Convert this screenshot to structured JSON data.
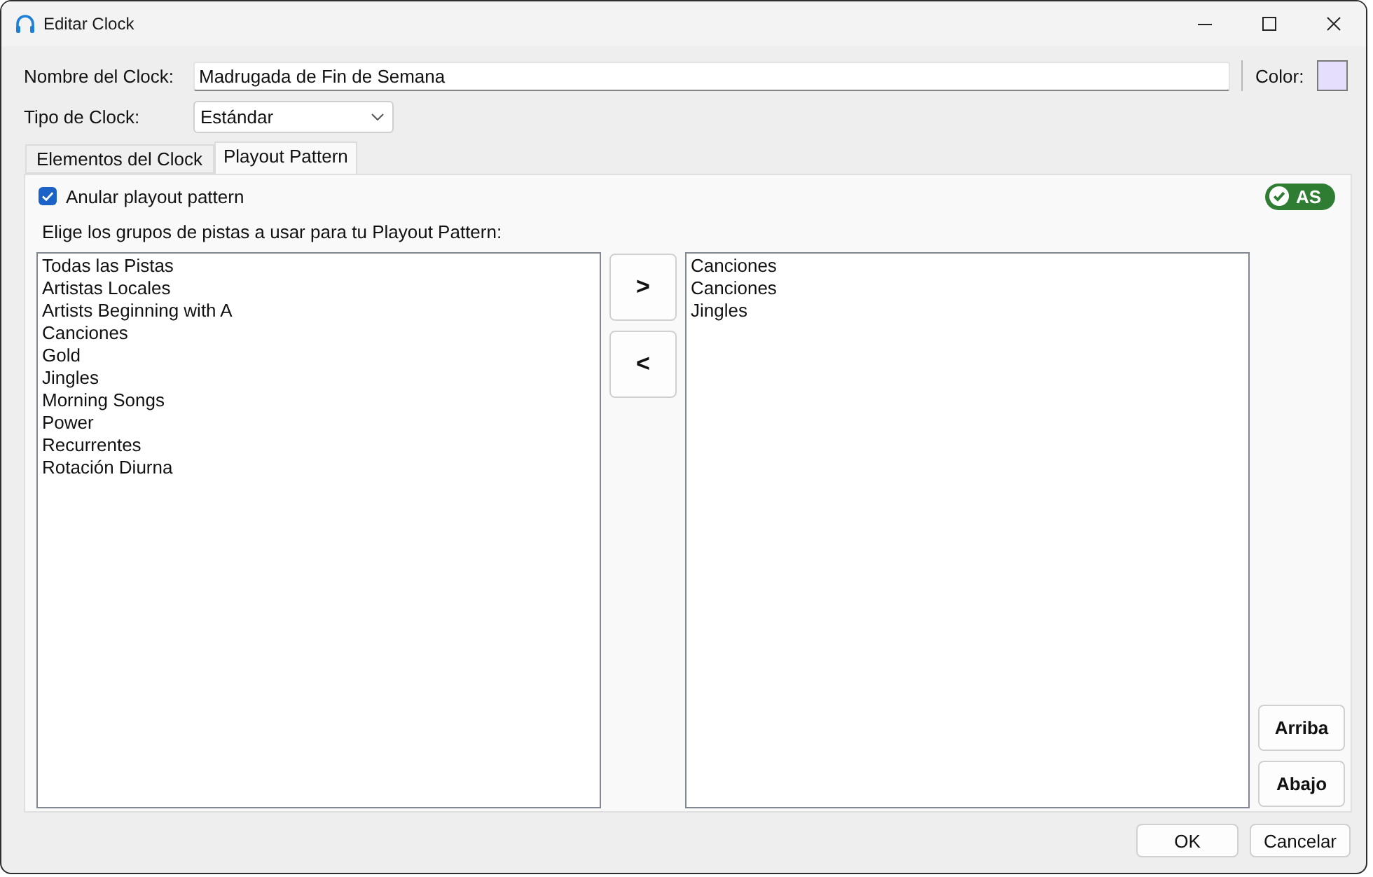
{
  "window": {
    "title": "Editar Clock"
  },
  "form": {
    "name": {
      "label": "Nombre del Clock:",
      "value": "Madrugada de Fin de Semana"
    },
    "color": {
      "label": "Color:",
      "color": "#e6dffc"
    },
    "type": {
      "label": "Tipo de Clock:",
      "value": "Estándar"
    }
  },
  "tabs": [
    {
      "label": "Elementos del Clock",
      "selected": false
    },
    {
      "label": "Playout Pattern",
      "selected": true
    }
  ],
  "playout": {
    "override": {
      "label": "Anular playout pattern",
      "checked": true
    },
    "badge": {
      "label": "AS"
    },
    "prompt": "Elige los grupos de pistas a usar para tu Playout Pattern:",
    "available": [
      "Todas las Pistas",
      "Artistas Locales",
      "Artists Beginning with A",
      "Canciones",
      "Gold",
      "Jingles",
      "Morning Songs",
      "Power",
      "Recurrentes",
      "Rotación Diurna"
    ],
    "chosen": [
      "Canciones",
      "Canciones",
      "Jingles"
    ],
    "move_buttons": [
      ">",
      "<"
    ],
    "order_buttons": [
      "Arriba",
      "Abajo"
    ]
  },
  "buttons": [
    "OK",
    "Cancelar"
  ]
}
